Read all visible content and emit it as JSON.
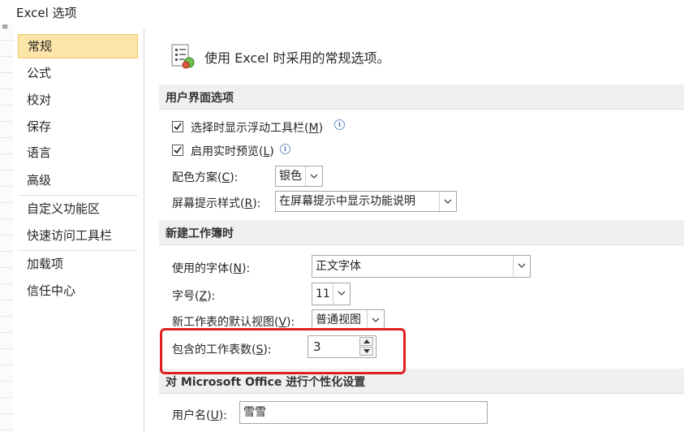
{
  "window": {
    "title": "Excel 选项"
  },
  "sidebar": {
    "items": [
      {
        "label": "常规"
      },
      {
        "label": "公式"
      },
      {
        "label": "校对"
      },
      {
        "label": "保存"
      },
      {
        "label": "语言"
      },
      {
        "label": "高级"
      },
      {
        "label": "自定义功能区"
      },
      {
        "label": "快速访问工具栏"
      },
      {
        "label": "加载项"
      },
      {
        "label": "信任中心"
      }
    ]
  },
  "header": {
    "text": "使用 Excel 时采用的常规选项。"
  },
  "ui_options": {
    "title": "用户界面选项",
    "mini_toolbar": {
      "label": "选择时显示浮动工具栏(",
      "key": "M",
      "end": ")",
      "checked": true
    },
    "live_preview": {
      "label": "启用实时预览(",
      "key": "L",
      "end": ")",
      "checked": true
    },
    "color_scheme": {
      "label": "配色方案(",
      "key": "C",
      "end": "):",
      "value": "银色"
    },
    "screentip": {
      "label": "屏幕提示样式(",
      "key": "R",
      "end": "):",
      "value": "在屏幕提示中显示功能说明"
    }
  },
  "new_workbook": {
    "title": "新建工作簿时",
    "font": {
      "label": "使用的字体(",
      "key": "N",
      "end": "):",
      "value": "正文字体"
    },
    "size": {
      "label": "字号(",
      "key": "Z",
      "end": "):",
      "value": "11"
    },
    "default_view": {
      "label": "新工作表的默认视图(",
      "key": "V",
      "end": "):",
      "value": "普通视图"
    },
    "sheets": {
      "label": "包含的工作表数(",
      "key": "S",
      "end": "):",
      "value": "3"
    }
  },
  "personalize": {
    "title": "对 Microsoft Office 进行个性化设置",
    "username": {
      "label": "用户名(",
      "key": "U",
      "end": "):",
      "value": "雪雪"
    }
  },
  "colors": {
    "selected_bg": "#fde5a8",
    "highlight": "#e02020"
  }
}
